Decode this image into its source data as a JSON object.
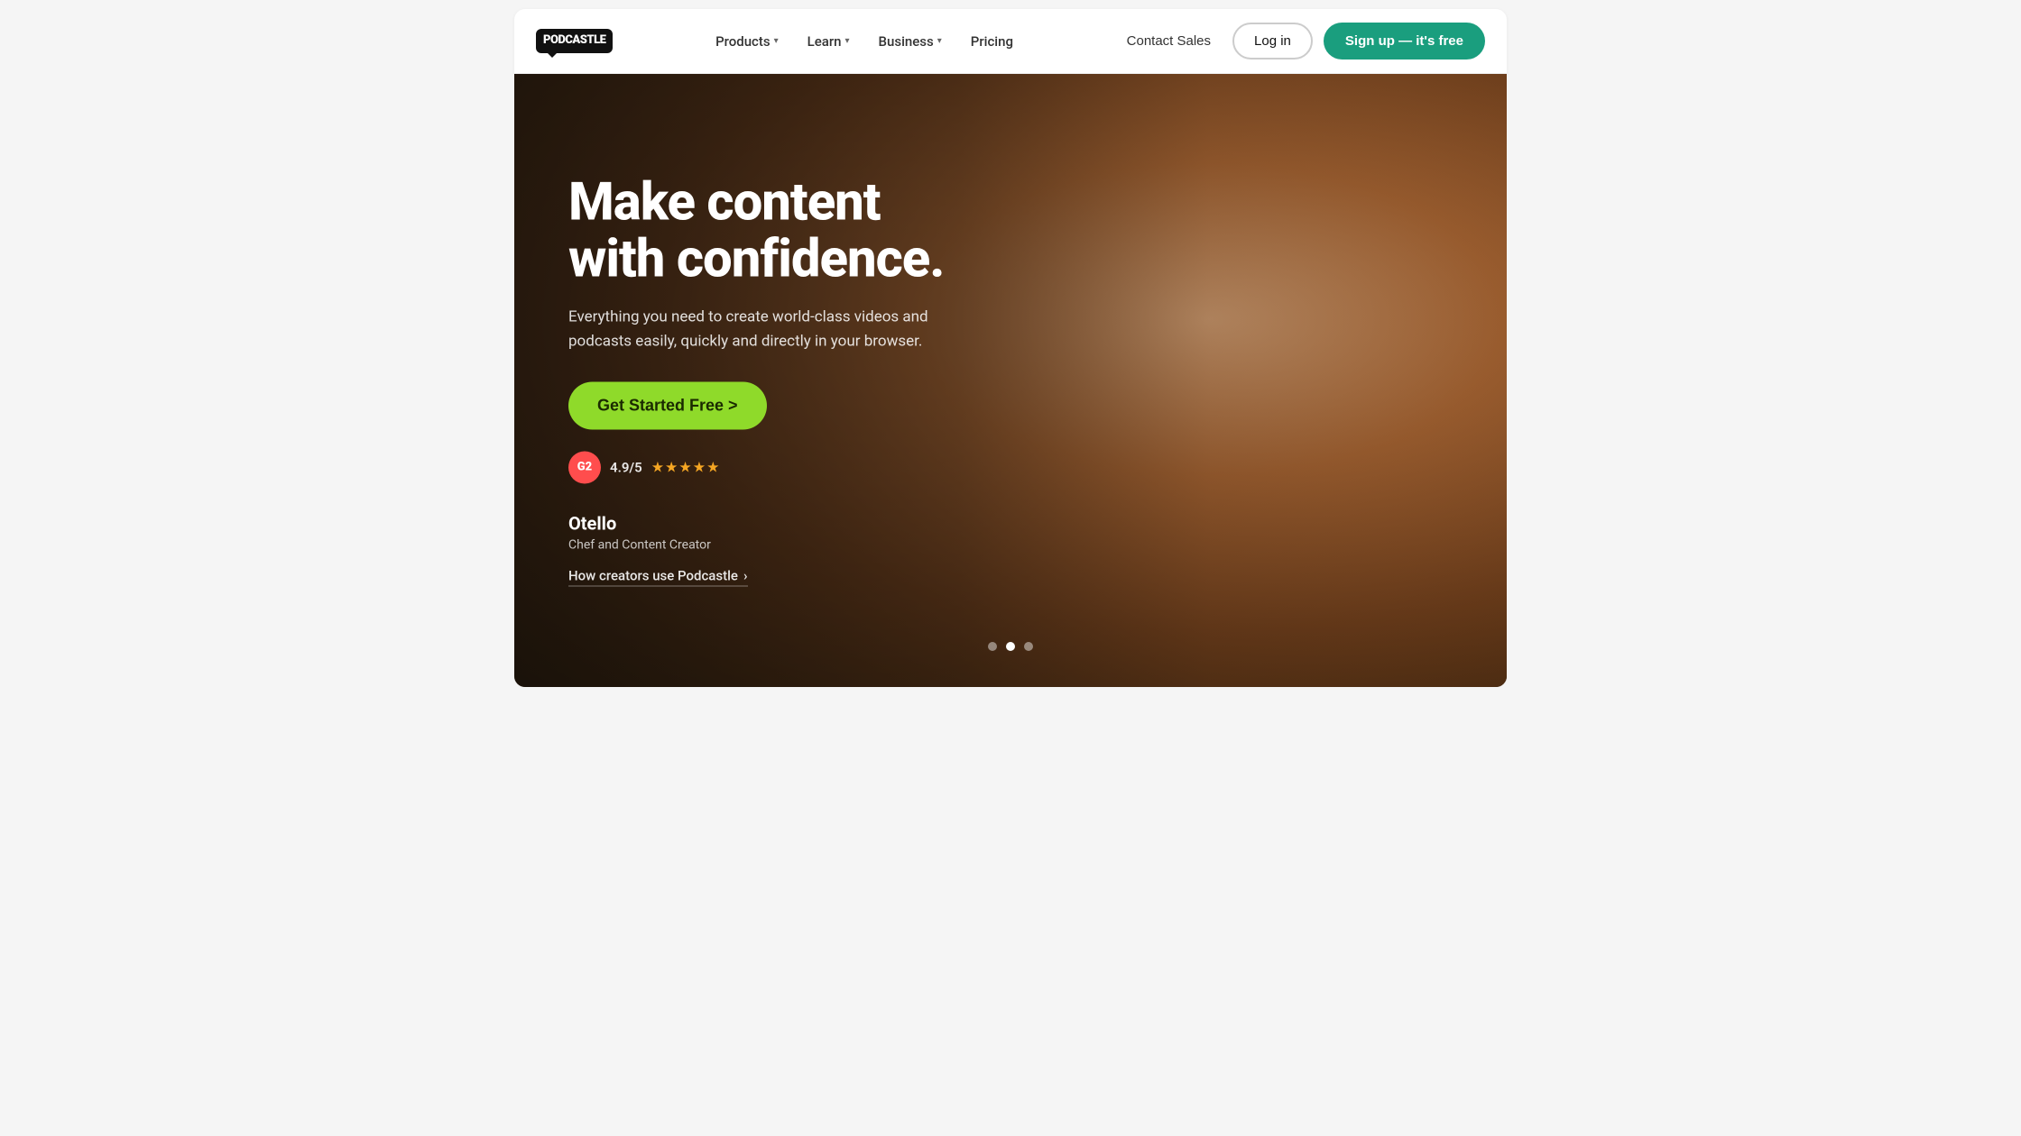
{
  "nav": {
    "logo_text": "PODCASTLE",
    "links": [
      {
        "label": "Products",
        "has_dropdown": true
      },
      {
        "label": "Learn",
        "has_dropdown": true
      },
      {
        "label": "Business",
        "has_dropdown": true
      },
      {
        "label": "Pricing",
        "has_dropdown": false
      }
    ],
    "contact_label": "Contact Sales",
    "login_label": "Log in",
    "signup_label": "Sign up — it's free"
  },
  "hero": {
    "headline_line1": "Make content",
    "headline_line2": "with confidence.",
    "subtext": "Everything you need to create world-class videos and podcasts easily, quickly and directly in your browser.",
    "cta_label": "Get Started Free >",
    "rating_score": "4.9/5",
    "rating_stars": "★★★★★",
    "g2_label": "G2",
    "testimonial_name": "Otello",
    "testimonial_role": "Chef and Content Creator",
    "creators_link": "How creators use Podcastle",
    "carousel_dots": [
      {
        "active": false
      },
      {
        "active": true
      },
      {
        "active": false
      }
    ]
  },
  "colors": {
    "nav_bg": "#ffffff",
    "signup_bg": "#1a9e7e",
    "cta_bg": "#8fda2a",
    "hero_overlay": "rgba(20,15,10,0.75)"
  }
}
